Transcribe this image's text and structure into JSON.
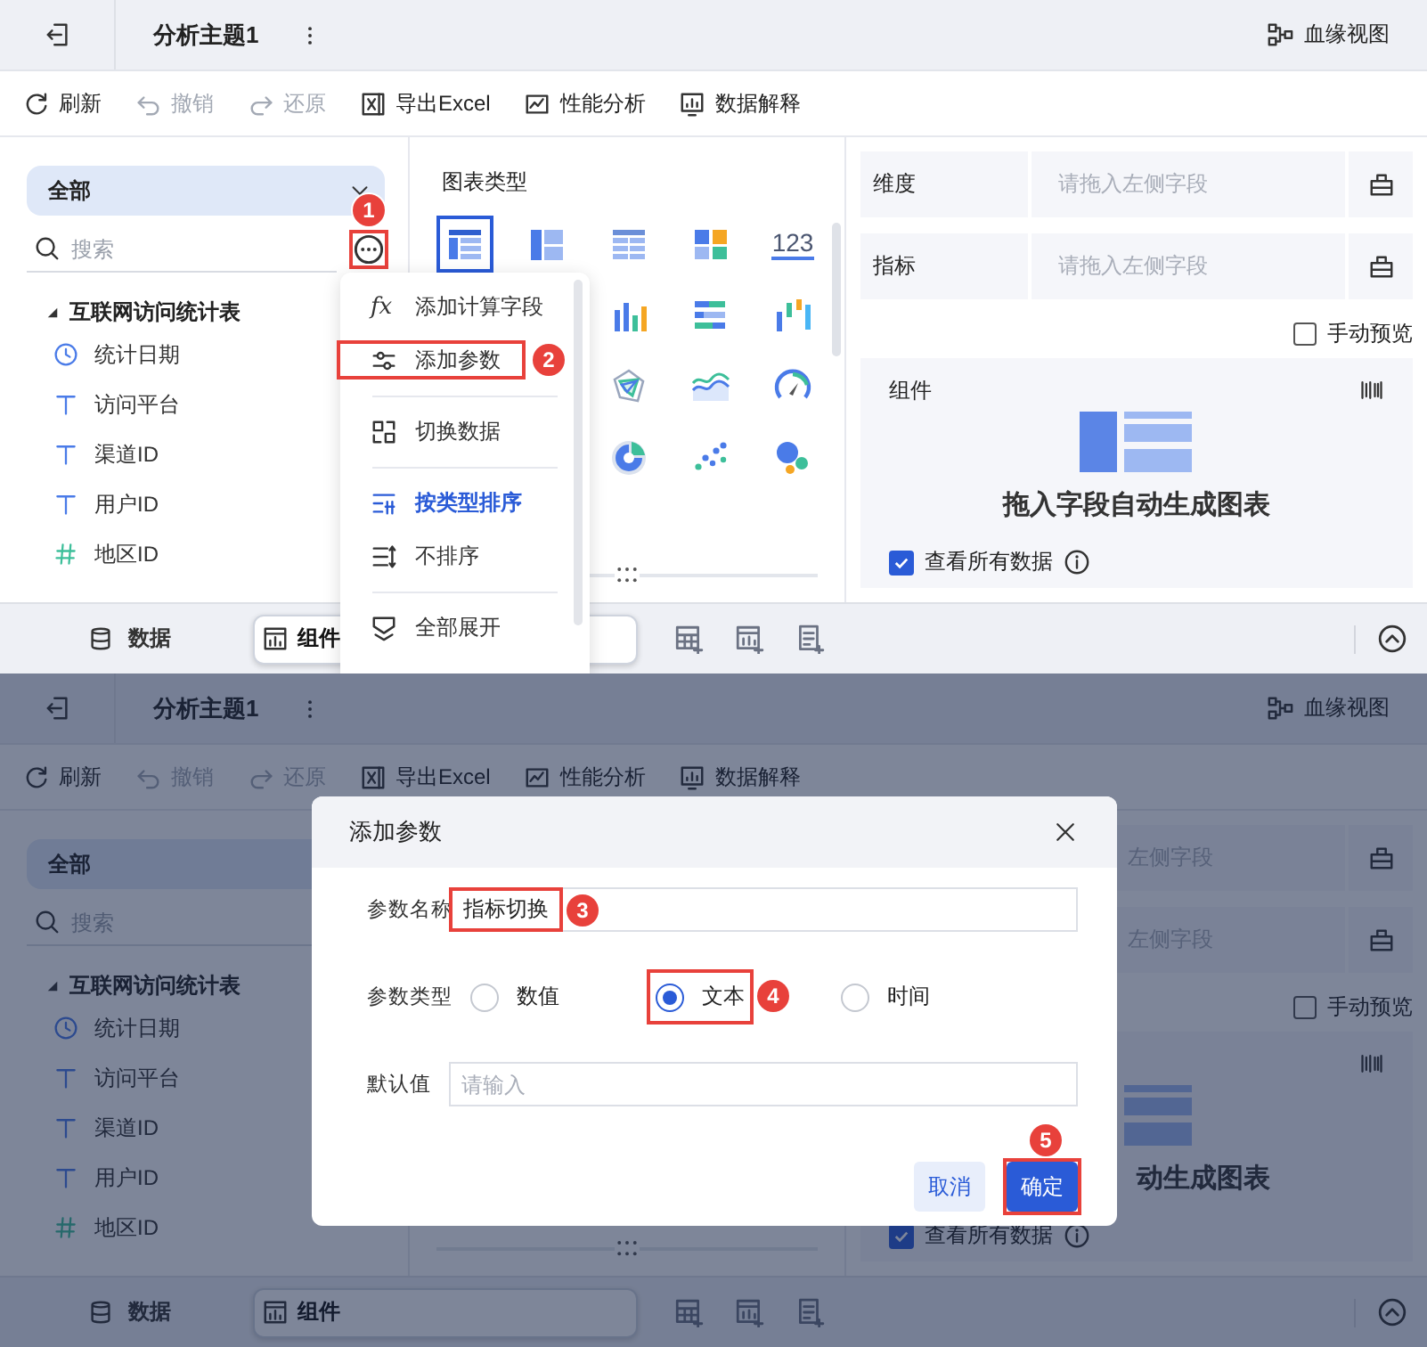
{
  "screens": [
    {
      "header": {
        "title": "分析主题1",
        "lineage_label": "血缘视图"
      },
      "toolbar": [
        {
          "label": "刷新",
          "disabled": false
        },
        {
          "label": "撤销",
          "disabled": true
        },
        {
          "label": "还原",
          "disabled": true
        },
        {
          "label": "导出Excel",
          "disabled": false
        },
        {
          "label": "性能分析",
          "disabled": false
        },
        {
          "label": "数据解释",
          "disabled": false
        }
      ],
      "field_panel": {
        "scope": "全部",
        "search_placeholder": "搜索",
        "more_button": {
          "step": "1"
        },
        "table": {
          "name": "互联网访问统计表",
          "expanded": true,
          "children": [
            {
              "name": "统计日期",
              "kind": "date"
            },
            {
              "name": "访问平台",
              "kind": "text"
            },
            {
              "name": "渠道ID",
              "kind": "text"
            },
            {
              "name": "用户ID",
              "kind": "text"
            },
            {
              "name": "地区ID",
              "kind": "number"
            }
          ]
        }
      },
      "chart_panel": {
        "title": "图表类型",
        "chart_types": [
          {
            "selected": true
          },
          {
            "selected": false
          },
          {
            "selected": false
          },
          {
            "selected": false
          },
          {
            "selected": false,
            "label": "123"
          },
          {
            "selected": false
          },
          {
            "selected": false
          },
          {
            "selected": false
          },
          {
            "selected": false
          },
          {
            "selected": false
          },
          {
            "selected": false
          },
          {
            "selected": false
          },
          {
            "selected": false
          },
          {
            "selected": false
          }
        ]
      },
      "settings_panel": {
        "rows": [
          {
            "label": "维度",
            "placeholder": "请拖入左侧字段"
          },
          {
            "label": "指标",
            "placeholder": "请拖入左侧字段"
          }
        ],
        "manual_preview": {
          "label": "手动预览",
          "checked": false
        },
        "widget": {
          "title": "组件",
          "hint": "拖入字段自动生成图表",
          "view_all": {
            "label": "查看所有数据",
            "checked": true
          }
        }
      },
      "bottom_tabs": [
        {
          "label": "数据",
          "selected": false
        },
        {
          "label": "组件",
          "selected": true
        }
      ],
      "field_menu": {
        "groups": [
          [
            {
              "label": "添加计算字段",
              "icon_text": "fx",
              "selected": false
            },
            {
              "label": "添加参数",
              "selected": false,
              "step": "2"
            }
          ],
          [
            {
              "label": "切换数据",
              "selected": false
            }
          ],
          [
            {
              "label": "按类型排序",
              "selected": true
            },
            {
              "label": "不排序",
              "selected": false
            }
          ],
          [
            {
              "label": "全部展开",
              "selected": false
            }
          ]
        ]
      }
    },
    {
      "header": {
        "title": "分析主题1",
        "lineage_label": "血缘视图"
      },
      "toolbar": [
        {
          "label": "刷新",
          "disabled": false
        },
        {
          "label": "撤销",
          "disabled": true
        },
        {
          "label": "还原",
          "disabled": true
        },
        {
          "label": "导出Excel",
          "disabled": false
        },
        {
          "label": "性能分析",
          "disabled": false
        },
        {
          "label": "数据解释",
          "disabled": false
        }
      ],
      "field_panel": {
        "scope": "全部",
        "search_placeholder": "搜索",
        "table": {
          "name": "互联网访问统计表",
          "expanded": true,
          "children": [
            {
              "name": "统计日期",
              "kind": "date"
            },
            {
              "name": "访问平台",
              "kind": "text"
            },
            {
              "name": "渠道ID",
              "kind": "text"
            },
            {
              "name": "用户ID",
              "kind": "text"
            },
            {
              "name": "地区ID",
              "kind": "number"
            }
          ]
        }
      },
      "settings_panel": {
        "rows": [
          {
            "placeholder": "左侧字段"
          },
          {
            "placeholder": "左侧字段"
          }
        ],
        "manual_preview": {
          "label": "手动预览",
          "checked": false
        },
        "widget": {
          "hint": "动生成图表",
          "view_all": {
            "label": "查看所有数据",
            "checked": true
          }
        }
      },
      "bottom_tabs": [
        {
          "label": "数据",
          "selected": false
        },
        {
          "label": "组件",
          "selected": true
        }
      ],
      "dialog": {
        "title": "添加参数",
        "fields": [
          {
            "kind": "text",
            "label": "参数名称",
            "value": "指标切换",
            "step": "3"
          },
          {
            "kind": "radio",
            "label": "参数类型",
            "options": [
              {
                "label": "数值",
                "selected": false
              },
              {
                "label": "文本",
                "selected": true,
                "step": "4"
              },
              {
                "label": "时间",
                "selected": false
              }
            ]
          },
          {
            "kind": "text",
            "label": "默认值",
            "placeholder": "请输入"
          }
        ],
        "buttons": [
          {
            "label": "取消",
            "kind": "secondary"
          },
          {
            "label": "确定",
            "kind": "primary",
            "step": "5"
          }
        ]
      }
    }
  ]
}
